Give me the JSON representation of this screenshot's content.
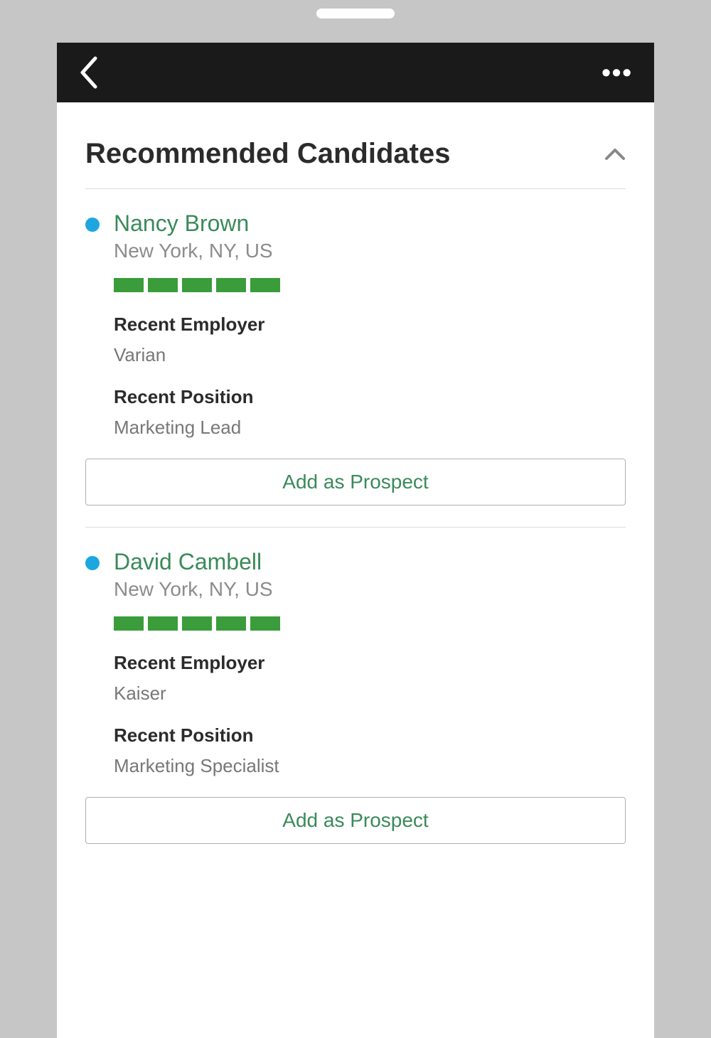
{
  "section": {
    "title": "Recommended Candidates"
  },
  "labels": {
    "recent_employer": "Recent Employer",
    "recent_position": "Recent Position",
    "add_prospect": "Add as Prospect"
  },
  "status_color": "#1ea6e0",
  "rating_color": "#3a9c3a",
  "candidates": [
    {
      "name": "Nancy Brown",
      "location": "New York, NY, US",
      "rating": 5,
      "recent_employer": "Varian",
      "recent_position": "Marketing Lead"
    },
    {
      "name": "David Cambell",
      "location": "New York, NY, US",
      "rating": 5,
      "recent_employer": "Kaiser",
      "recent_position": "Marketing Specialist"
    }
  ]
}
